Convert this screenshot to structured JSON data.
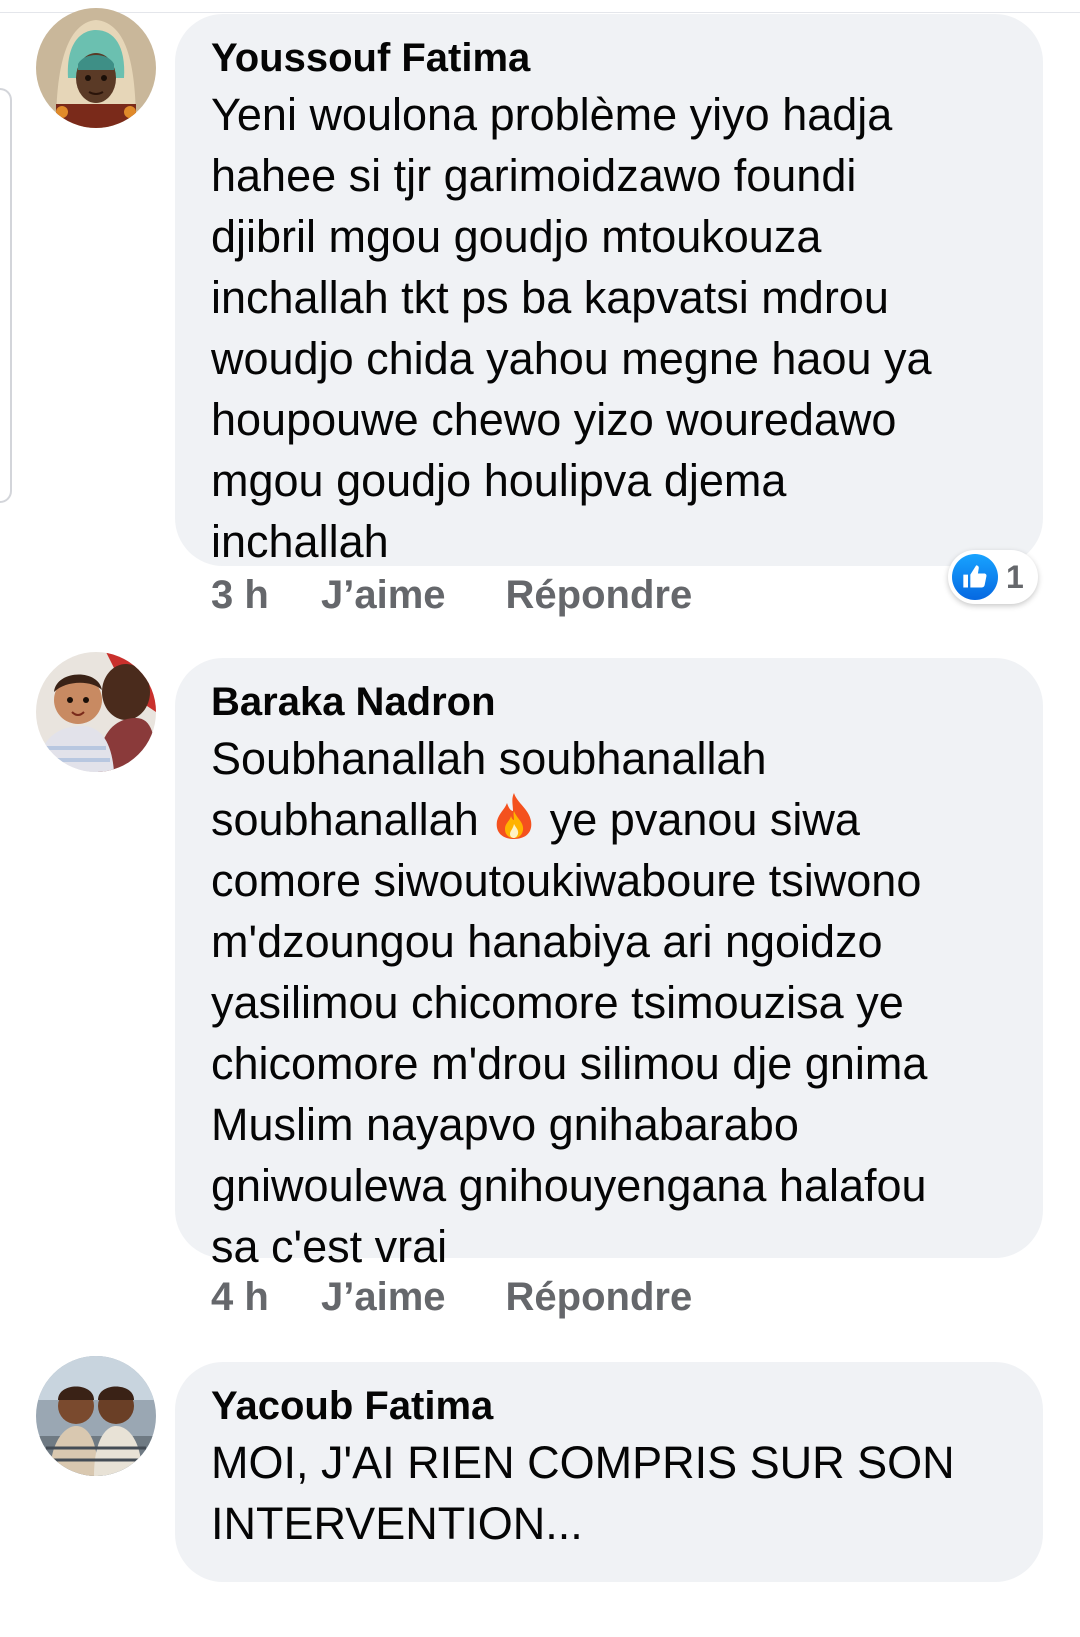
{
  "comments": [
    {
      "author": "Youssouf Fatima",
      "text": "Yeni woulona problème yiyo hadja\nhahee si tjr garimoidzawo foundi\ndjibril mgou goudjo mtoukouza\ninchallah  tkt ps ba kapvatsi mdrou\nwoudjo chida yahou megne haou ya\nhoupouwe chewo yizo wouredawo\nmgou goudjo houlipva djema\ninchallah",
      "time": "3 h",
      "like_label": "J’aime",
      "reply_label": "Répondre",
      "reaction_count": "1",
      "reaction_icon": "thumbs-up-icon"
    },
    {
      "author": "Baraka Nadron",
      "text_line1": "Soubhanallah soubhanallah",
      "text_line2_before": "soubhanallah",
      "emoji": "fire-emoji-icon",
      "text_line2_after": " ye pvanou siwa",
      "text_rest": "comore siwoutoukiwaboure tsiwono\nm'dzoungou hanabiya ari ngoidzo\nyasilimou chicomore tsimouzisa ye\nchicomore m'drou silimou dje gnima\nMuslim nayapvo gnihabarabo\ngniwoulewa gnihouyengana halafou\nsa c'est vrai",
      "time": "4 h",
      "like_label": "J’aime",
      "reply_label": "Répondre"
    },
    {
      "author": "Yacoub Fatima",
      "text": "MOI, J'AI RIEN COMPRIS SUR SON\nINTERVENTION..."
    }
  ],
  "colors": {
    "bubble": "#f0f2f5",
    "meta_text": "#65676b",
    "like_blue": "#1877f2"
  }
}
